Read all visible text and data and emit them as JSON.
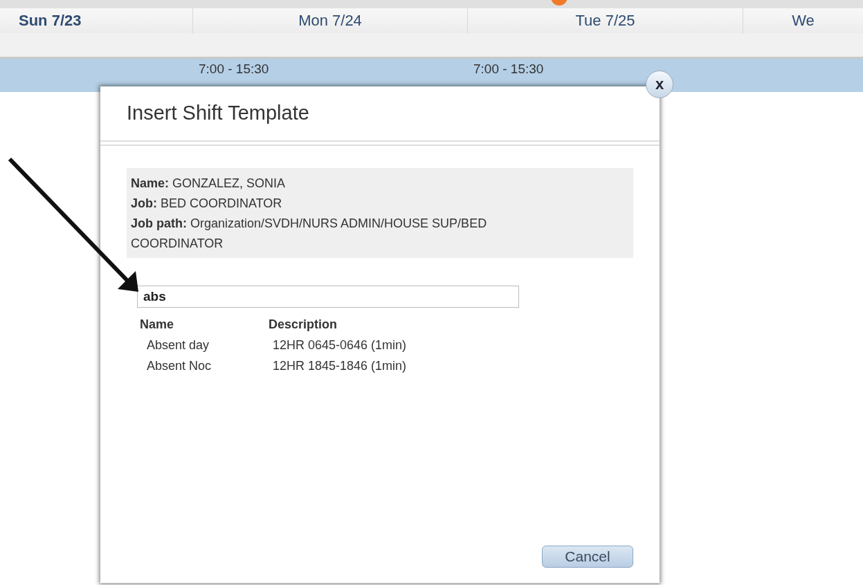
{
  "calendar": {
    "days": [
      {
        "label": "Sun 7/23",
        "selected": true
      },
      {
        "label": "Mon 7/24",
        "selected": false,
        "shift": "7:00 - 15:30"
      },
      {
        "label": "Tue 7/25",
        "selected": false,
        "shift": "7:00 - 15:30"
      },
      {
        "label": "We",
        "selected": false
      }
    ]
  },
  "dialog": {
    "close": "x",
    "title": "Insert Shift Template",
    "info": [
      {
        "label": "Name:",
        "value": "GONZALEZ, SONIA"
      },
      {
        "label": "Job:",
        "value": "BED COORDINATOR"
      },
      {
        "label": "Job path:",
        "value": "Organization/SVDH/NURS ADMIN/HOUSE SUP/BED COORDINATOR"
      }
    ],
    "search": {
      "value": "abs"
    },
    "table": {
      "columns": [
        "Name",
        "Description"
      ],
      "rows": [
        [
          "Absent day",
          "12HR 0645-0646 (1min)"
        ],
        [
          "Absent Noc",
          "12HR 1845-1846 (1min)"
        ]
      ]
    },
    "buttons": [
      "Cancel"
    ]
  }
}
